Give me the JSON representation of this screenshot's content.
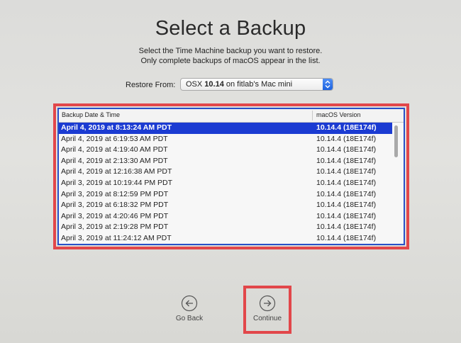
{
  "title": "Select a Backup",
  "subtitle_line1": "Select the Time Machine backup you want to restore.",
  "subtitle_line2": "Only complete backups of macOS appear in the list.",
  "restore_from": {
    "label": "Restore From:",
    "selected_prefix": "OSX ",
    "selected_version": "10.14",
    "selected_suffix": " on fitlab's Mac mini"
  },
  "table": {
    "columns": [
      "Backup Date & Time",
      "macOS Version"
    ],
    "rows": [
      {
        "date": "April 4, 2019 at 8:13:24 AM PDT",
        "version": "10.14.4 (18E174f)",
        "selected": true
      },
      {
        "date": "April 4, 2019 at 6:19:53 AM PDT",
        "version": "10.14.4 (18E174f)"
      },
      {
        "date": "April 4, 2019 at 4:19:40 AM PDT",
        "version": "10.14.4 (18E174f)"
      },
      {
        "date": "April 4, 2019 at 2:13:30 AM PDT",
        "version": "10.14.4 (18E174f)"
      },
      {
        "date": "April 4, 2019 at 12:16:38 AM PDT",
        "version": "10.14.4 (18E174f)"
      },
      {
        "date": "April 3, 2019 at 10:19:44 PM PDT",
        "version": "10.14.4 (18E174f)"
      },
      {
        "date": "April 3, 2019 at 8:12:59 PM PDT",
        "version": "10.14.4 (18E174f)"
      },
      {
        "date": "April 3, 2019 at 6:18:32 PM PDT",
        "version": "10.14.4 (18E174f)"
      },
      {
        "date": "April 3, 2019 at 4:20:46 PM PDT",
        "version": "10.14.4 (18E174f)"
      },
      {
        "date": "April 3, 2019 at 2:19:28 PM PDT",
        "version": "10.14.4 (18E174f)"
      },
      {
        "date": "April 3, 2019 at 11:24:12 AM PDT",
        "version": "10.14.4 (18E174f)"
      }
    ]
  },
  "buttons": {
    "go_back": "Go Back",
    "continue": "Continue"
  },
  "icons": {
    "go_back": "arrow-left-circle-icon",
    "continue": "arrow-right-circle-icon",
    "select_stepper": "chevron-up-down-icon"
  },
  "colors": {
    "selection": "#1b3bd2",
    "highlight_box": "#e2474a",
    "stepper": "#1d63e0"
  }
}
